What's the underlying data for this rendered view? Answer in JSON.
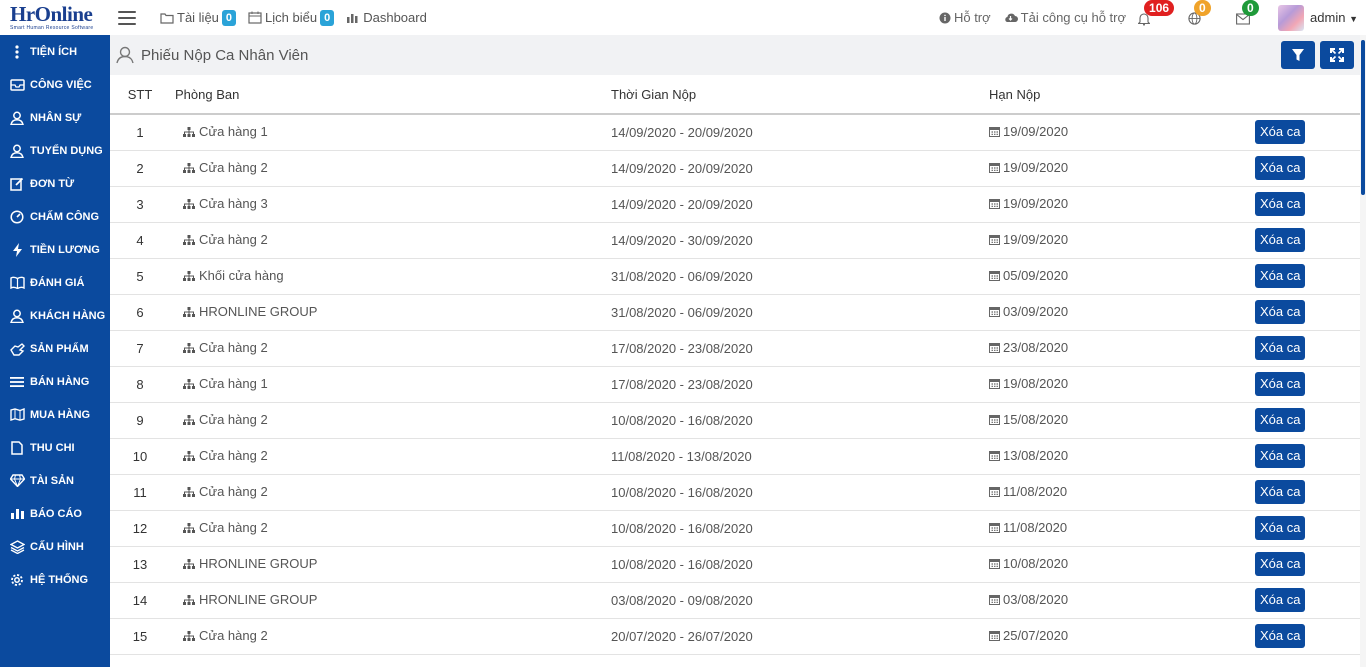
{
  "brand": {
    "name": "HrOnline",
    "tagline": "Smart Human Resource Software"
  },
  "nav": {
    "links": [
      {
        "label": "Tài liệu",
        "count": "0"
      },
      {
        "label": "Lịch biểu",
        "count": "0"
      },
      {
        "label": "Dashboard"
      }
    ],
    "support": "Hỗ trợ",
    "download": "Tải công cụ hỗ trợ",
    "notifications": {
      "bell": "106",
      "globe": "0",
      "mail": "0"
    },
    "user": "admin"
  },
  "sidebar": {
    "items": [
      {
        "label": "TIỆN ÍCH",
        "icon": "dots-vertical-icon"
      },
      {
        "label": "CÔNG VIỆC",
        "icon": "inbox-icon"
      },
      {
        "label": "NHÂN SỰ",
        "icon": "user-icon"
      },
      {
        "label": "TUYỂN DỤNG",
        "icon": "user-icon"
      },
      {
        "label": "ĐƠN TỪ",
        "icon": "edit-icon"
      },
      {
        "label": "CHẤM CÔNG",
        "icon": "gauge-icon"
      },
      {
        "label": "TIỀN LƯƠNG",
        "icon": "bolt-icon"
      },
      {
        "label": "ĐÁNH GIÁ",
        "icon": "book-icon"
      },
      {
        "label": "KHÁCH HÀNG",
        "icon": "user-icon"
      },
      {
        "label": "SẢN PHẨM",
        "icon": "hand-icon"
      },
      {
        "label": "BÁN HÀNG",
        "icon": "list-icon"
      },
      {
        "label": "MUA HÀNG",
        "icon": "map-icon"
      },
      {
        "label": "THU CHI",
        "icon": "file-icon"
      },
      {
        "label": "TÀI SẢN",
        "icon": "diamond-icon"
      },
      {
        "label": "BÁO CÁO",
        "icon": "bar-chart-icon"
      },
      {
        "label": "CẤU HÌNH",
        "icon": "layers-icon"
      },
      {
        "label": "HỆ THỐNG",
        "icon": "gear-icon"
      }
    ]
  },
  "page": {
    "title": "Phiếu Nộp Ca Nhân Viên"
  },
  "table": {
    "headers": {
      "stt": "STT",
      "dept": "Phòng Ban",
      "time": "Thời Gian Nộp",
      "due": "Hạn Nộp"
    },
    "action_label": "Xóa ca",
    "rows": [
      {
        "stt": "1",
        "dept": "Cửa hàng 1",
        "time": "14/09/2020 - 20/09/2020",
        "due": "19/09/2020"
      },
      {
        "stt": "2",
        "dept": "Cửa hàng 2",
        "time": "14/09/2020 - 20/09/2020",
        "due": "19/09/2020"
      },
      {
        "stt": "3",
        "dept": "Cửa hàng 3",
        "time": "14/09/2020 - 20/09/2020",
        "due": "19/09/2020"
      },
      {
        "stt": "4",
        "dept": "Cửa hàng 2",
        "time": "14/09/2020 - 30/09/2020",
        "due": "19/09/2020"
      },
      {
        "stt": "5",
        "dept": "Khối cửa hàng",
        "time": "31/08/2020 - 06/09/2020",
        "due": "05/09/2020"
      },
      {
        "stt": "6",
        "dept": "HRONLINE GROUP",
        "time": "31/08/2020 - 06/09/2020",
        "due": "03/09/2020"
      },
      {
        "stt": "7",
        "dept": "Cửa hàng 2",
        "time": "17/08/2020 - 23/08/2020",
        "due": "23/08/2020"
      },
      {
        "stt": "8",
        "dept": "Cửa hàng 1",
        "time": "17/08/2020 - 23/08/2020",
        "due": "19/08/2020"
      },
      {
        "stt": "9",
        "dept": "Cửa hàng 2",
        "time": "10/08/2020 - 16/08/2020",
        "due": "15/08/2020"
      },
      {
        "stt": "10",
        "dept": "Cửa hàng 2",
        "time": "11/08/2020 - 13/08/2020",
        "due": "13/08/2020"
      },
      {
        "stt": "11",
        "dept": "Cửa hàng 2",
        "time": "10/08/2020 - 16/08/2020",
        "due": "11/08/2020"
      },
      {
        "stt": "12",
        "dept": "Cửa hàng 2",
        "time": "10/08/2020 - 16/08/2020",
        "due": "11/08/2020"
      },
      {
        "stt": "13",
        "dept": "HRONLINE GROUP",
        "time": "10/08/2020 - 16/08/2020",
        "due": "10/08/2020"
      },
      {
        "stt": "14",
        "dept": "HRONLINE GROUP",
        "time": "03/08/2020 - 09/08/2020",
        "due": "03/08/2020"
      },
      {
        "stt": "15",
        "dept": "Cửa hàng 2",
        "time": "20/07/2020 - 26/07/2020",
        "due": "25/07/2020"
      }
    ]
  }
}
